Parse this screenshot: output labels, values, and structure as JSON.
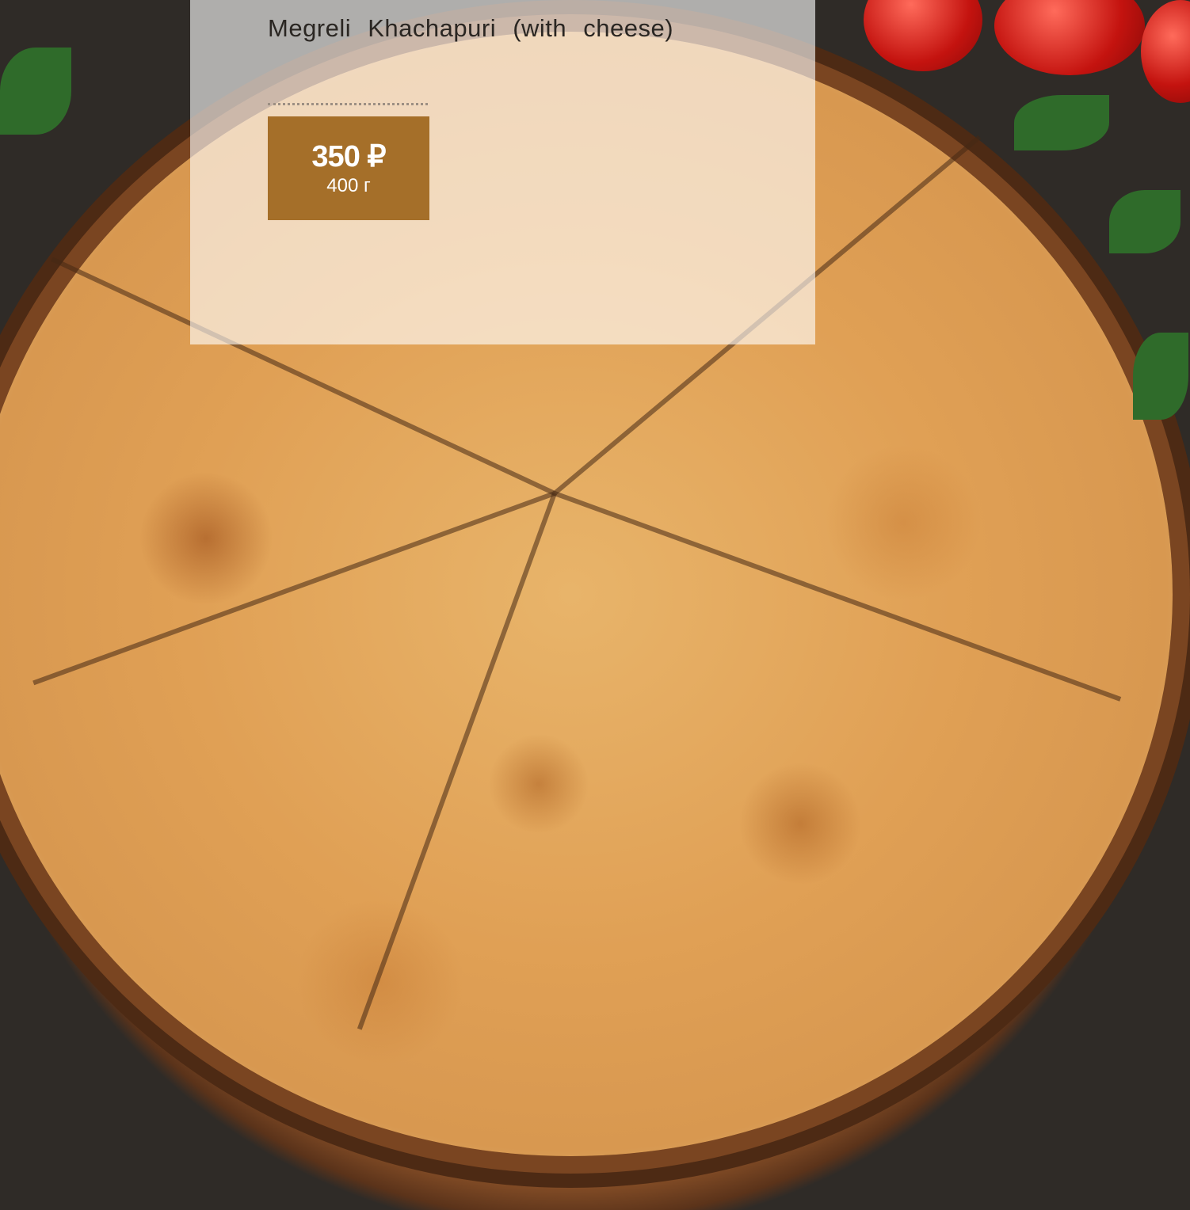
{
  "menu_item": {
    "name": "Megreli Khachapuri (with cheese)",
    "price": "350 ₽",
    "weight": "400 г"
  },
  "colors": {
    "price_box": "#a56f29",
    "overlay": "rgba(255,255,255,0.62)",
    "title_text": "#2a2622"
  }
}
